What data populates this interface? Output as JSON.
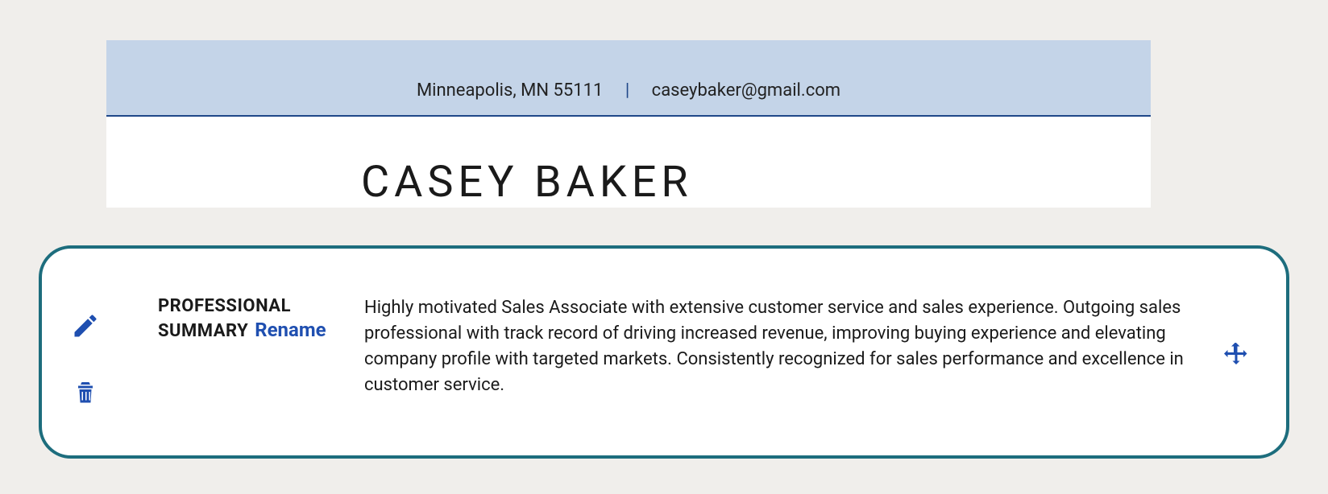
{
  "header": {
    "location": "Minneapolis, MN 55111",
    "email": "caseybaker@gmail.com"
  },
  "name": "CASEY BAKER",
  "section": {
    "label": "PROFESSIONAL SUMMARY",
    "rename_label": "Rename",
    "body": "Highly motivated Sales Associate with extensive customer service and sales experience. Outgoing sales professional with track record of driving increased revenue, improving buying experience and elevating company profile with targeted markets. Consistently recognized for sales performance and excellence in customer service."
  }
}
